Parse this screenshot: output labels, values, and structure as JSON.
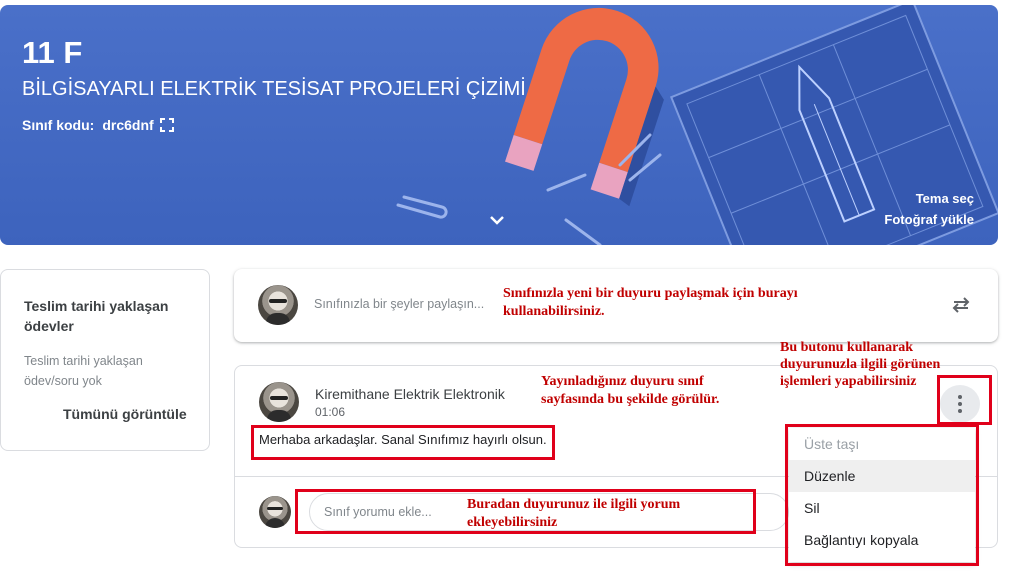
{
  "banner": {
    "title": "11 F",
    "subtitle": "BİLGİSAYARLI ELEKTRİK TESİSAT PROJELERİ ÇİZİMİ",
    "class_code_label": "Sınıf kodu:",
    "class_code": "drc6dnf",
    "theme_link": "Tema seç",
    "photo_link": "Fotoğraf yükle",
    "bg_color": "#4169c8"
  },
  "upcoming": {
    "title": "Teslim tarihi yaklaşan ödevler",
    "empty_text": "Teslim tarihi yaklaşan ödev/soru yok",
    "view_all": "Tümünü görüntüle"
  },
  "share": {
    "placeholder": "Sınıfınızla bir şeyler paylaşın..."
  },
  "post": {
    "author": "Kiremithane Elektrik Elektronik",
    "time": "01:06",
    "body": "Merhaba arkadaşlar. Sanal Sınıfımız hayırlı olsun.",
    "comment_placeholder": "Sınıf yorumu ekle..."
  },
  "menu": {
    "items": [
      {
        "label": "Üste taşı",
        "state": "disabled"
      },
      {
        "label": "Düzenle",
        "state": "hover"
      },
      {
        "label": "Sil",
        "state": "normal"
      },
      {
        "label": "Bağlantıyı kopyala",
        "state": "normal"
      }
    ]
  },
  "annotations": {
    "share_note": "Sınıfınızla yeni bir duyuru paylaşmak için burayı kullanabilirsiniz.",
    "button_note": "Bu butonu kullanarak duyurunuzla ilgili görünen işlemleri yapabilirsiniz",
    "post_note": "Yayınladığınız duyuru sınıf sayfasında bu şekilde görülür.",
    "comment_note": "Buradan duyurunuz ile ilgili yorum ekleyebilirsiniz",
    "color": "#e0001a"
  }
}
